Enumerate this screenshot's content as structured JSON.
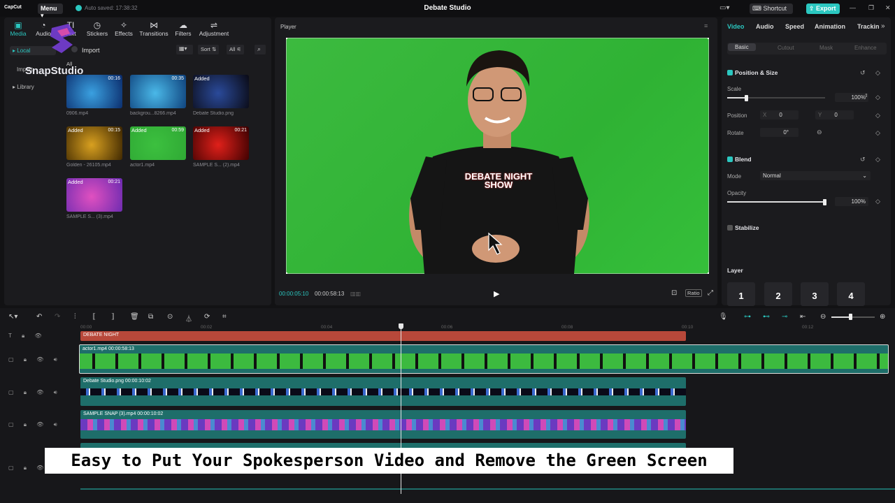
{
  "titlebar": {
    "logo": "CapCut",
    "menu": "Menu",
    "autosave": "Auto saved: 17:38:32",
    "title": "Debate Studio",
    "shortcut": "Shortcut",
    "export": "Export"
  },
  "media_tabs": [
    {
      "label": "Media",
      "icon": "media-icon"
    },
    {
      "label": "Audio",
      "icon": "audio-icon"
    },
    {
      "label": "Text",
      "icon": "text-icon"
    },
    {
      "label": "Stickers",
      "icon": "stickers-icon"
    },
    {
      "label": "Effects",
      "icon": "effects-icon"
    },
    {
      "label": "Transitions",
      "icon": "transitions-icon"
    },
    {
      "label": "Filters",
      "icon": "filters-icon"
    },
    {
      "label": "Adjustment",
      "icon": "adjustment-icon"
    }
  ],
  "side": {
    "local": "Local",
    "import_sub": "Import",
    "library": "Library",
    "import_btn": "Import",
    "all_sub": "All"
  },
  "media_toolbar": {
    "sort": "Sort",
    "all": "All"
  },
  "media_items": [
    {
      "name": "0906.mp4",
      "badge": "",
      "duration": "00:16",
      "colors": [
        "#0a2a6a",
        "#3aa0e0"
      ]
    },
    {
      "name": "backgrou...8266.mp4",
      "badge": "",
      "duration": "00:35",
      "colors": [
        "#0d3f7a",
        "#4ab8e8"
      ]
    },
    {
      "name": "Debate Studio.png",
      "badge": "Added",
      "duration": "",
      "colors": [
        "#0a0a14",
        "#2a4a9a"
      ]
    },
    {
      "name": "Golden - 26105.mp4",
      "badge": "Added",
      "duration": "00:15",
      "colors": [
        "#3a2400",
        "#d8a020"
      ]
    },
    {
      "name": "actor1.mp4",
      "badge": "Added",
      "duration": "00:59",
      "colors": [
        "#2fa834",
        "#3cc03f"
      ]
    },
    {
      "name": "SAMPLE S... (2).mp4",
      "badge": "Added",
      "duration": "00:21",
      "colors": [
        "#3a0000",
        "#e0201a"
      ]
    },
    {
      "name": "SAMPLE S... (3).mp4",
      "badge": "Added",
      "duration": "00:21",
      "colors": [
        "#6a2ab0",
        "#e050c0"
      ]
    }
  ],
  "player": {
    "title": "Player",
    "timecode": "00:00:05:10",
    "duration": "00:00:58:13",
    "ratio": "Ratio",
    "shirt_text": "DEBATE NIGHT SHOW"
  },
  "inspector": {
    "tabs": [
      "Video",
      "Audio",
      "Speed",
      "Animation",
      "Trackin"
    ],
    "subtabs": [
      "Basic",
      "Cutout",
      "Mask",
      "Enhance"
    ],
    "position_size": "Position & Size",
    "scale_label": "Scale",
    "scale_value": "100%",
    "scale_fraction": 0.2,
    "position_label": "Position",
    "pos_x_label": "X",
    "pos_x": "0",
    "pos_y_label": "Y",
    "pos_y": "0",
    "rotate_label": "Rotate",
    "rotate_value": "0°",
    "blend": "Blend",
    "mode_label": "Mode",
    "mode_value": "Normal",
    "opacity_label": "Opacity",
    "opacity_value": "100%",
    "opacity_fraction": 1.0,
    "stabilize": "Stabilize",
    "layer_label": "Layer",
    "layers": [
      "1",
      "2",
      "3",
      "4"
    ]
  },
  "timeline": {
    "ticks": [
      "00:00",
      "00:02",
      "00:04",
      "00:06",
      "00:08",
      "00:10",
      "00:12"
    ],
    "text_clip": "DEBATE NIGHT",
    "clips": [
      {
        "label": "actor1.mp4  00:00:58:13"
      },
      {
        "label": "Debate Studio.png  00:00:10:02"
      },
      {
        "label": "SAMPLE SNAP (3).mp4  00:00:10:02"
      }
    ]
  },
  "caption": "Easy to Put Your Spokesperson Video and Remove the Green Screen",
  "watermark": "SnapStudio",
  "colors": {
    "accent": "#2bc7c0",
    "text_clip": "#b8483a",
    "video_clip": "#1e6e6a"
  }
}
